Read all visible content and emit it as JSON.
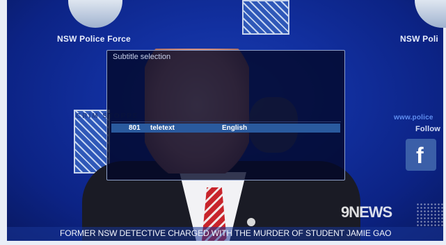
{
  "background": {
    "police_left": "NSW Police Force",
    "police_right": "NSW Poli",
    "crime_stoppers": "CRIM STOPPE",
    "website": "www.police",
    "follow": "Follow",
    "facebook_glyph": "f"
  },
  "dialog": {
    "title": "Subtitle selection",
    "tracks": [
      {
        "number": "801",
        "type": "teletext",
        "language": "English",
        "selected": true
      }
    ]
  },
  "overlay": {
    "channel_logo": "9NEWS",
    "ticker": "FORMER NSW DETECTIVE CHARGED WITH THE MURDER OF STUDENT JAMIE GAO"
  },
  "colors": {
    "selection": "#2a5a9e",
    "dialog_bg": "#020828",
    "accent_blue": "#1230a0"
  }
}
